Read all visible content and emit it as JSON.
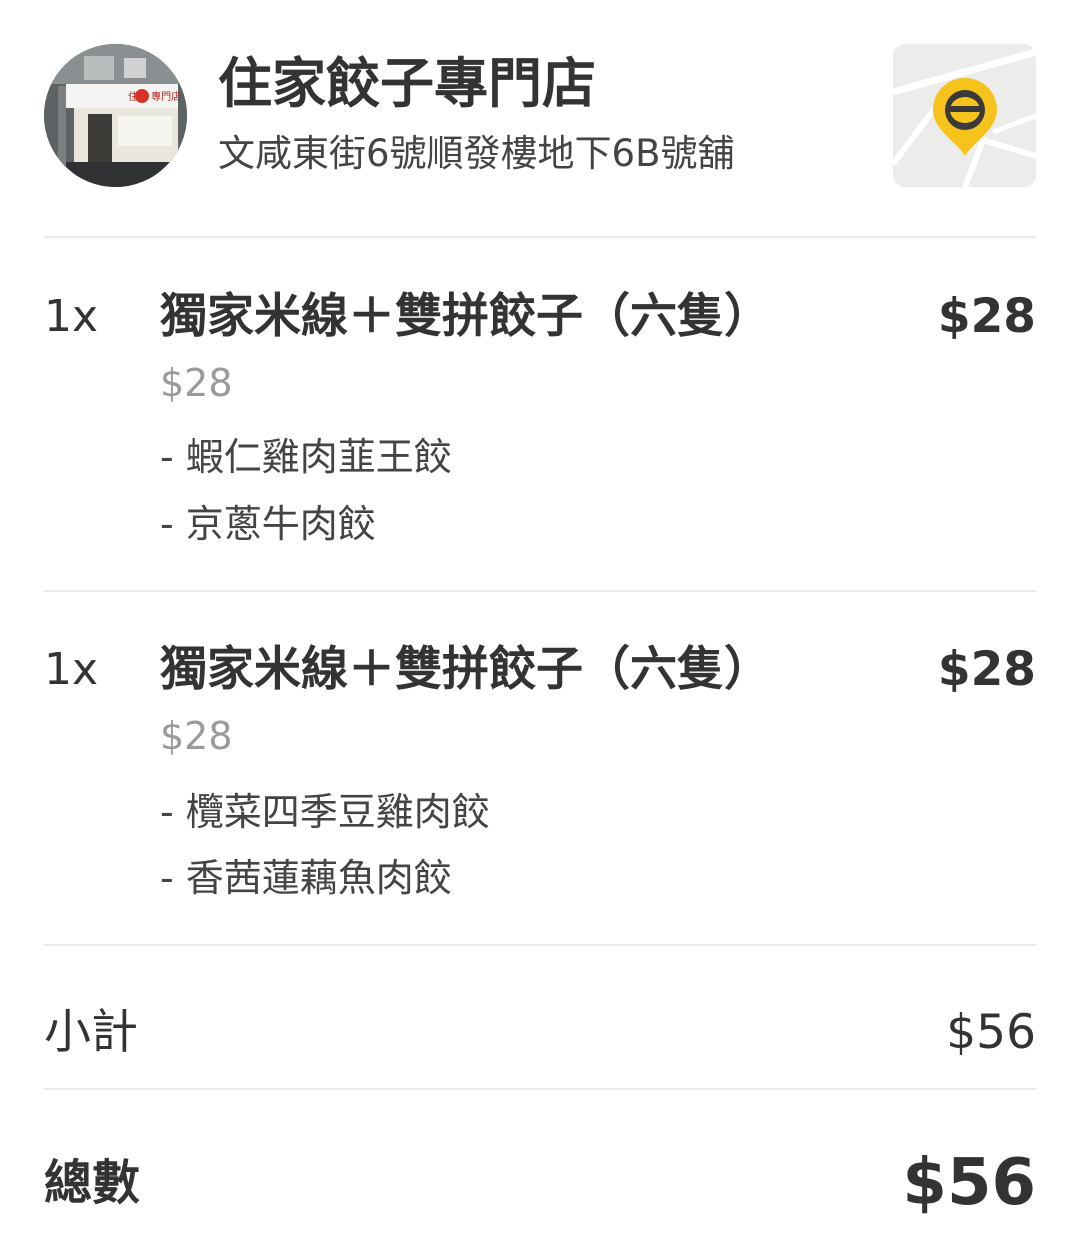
{
  "store": {
    "name": "住家餃子專門店",
    "address": "文咸東街6號順發樓地下6B號舖",
    "photo_sign_text": "住家 專門店",
    "map_pin_color": "#f6c21c"
  },
  "items": [
    {
      "qty": "1x",
      "name": "獨家米線＋雙拼餃子（六隻）",
      "price": "$28",
      "unit_price": "$28",
      "options": [
        "- 蝦仁雞肉韮王餃",
        "- 京蔥牛肉餃"
      ]
    },
    {
      "qty": "1x",
      "name": "獨家米線＋雙拼餃子（六隻）",
      "price": "$28",
      "unit_price": "$28",
      "options": [
        "- 欖菜四季豆雞肉餃",
        "- 香茜蓮藕魚肉餃"
      ]
    }
  ],
  "summary": {
    "subtotal_label": "小計",
    "subtotal_value": "$56",
    "total_label": "總數",
    "total_value": "$56"
  }
}
